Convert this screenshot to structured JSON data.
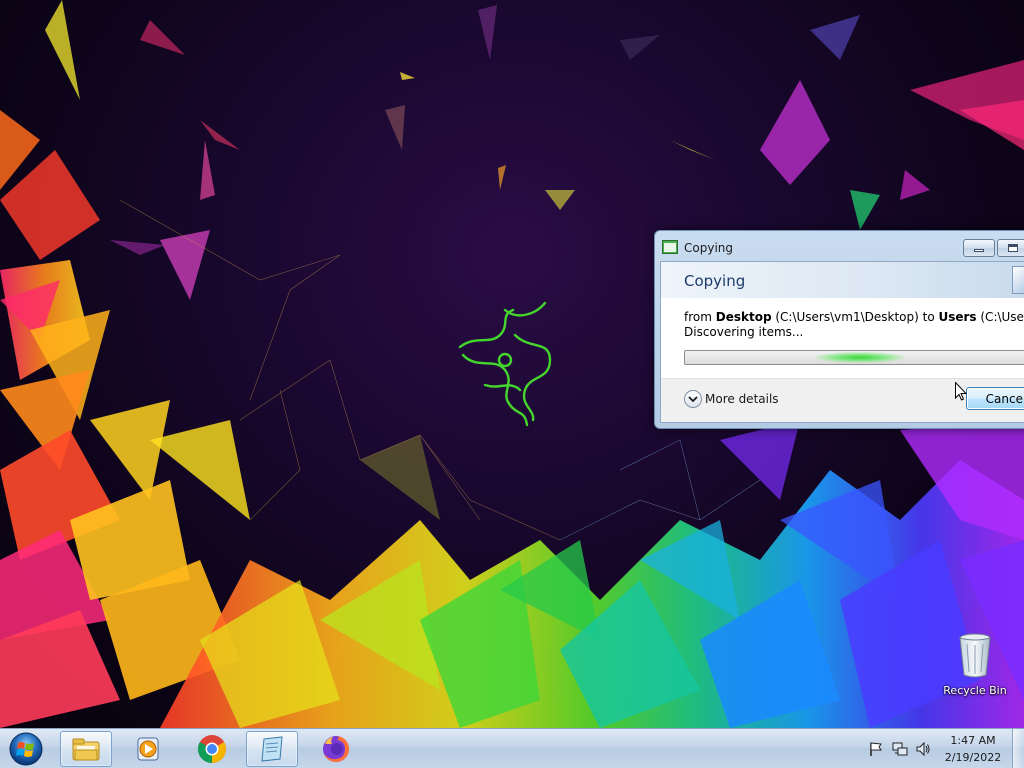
{
  "desktop": {
    "wallpaper": "razer-polygon-wallpaper",
    "recycle_bin": {
      "label": "Recycle Bin",
      "icon": "recycle-bin-icon"
    }
  },
  "copy_dialog": {
    "window_title": "Copying",
    "heading": "Copying",
    "from_prefix": "from ",
    "source_name": "Desktop",
    "source_path": " (C:\\Users\\vm1\\Desktop) to ",
    "dest_name": "Users",
    "dest_path": " (C:\\Users)",
    "status": "Discovering items...",
    "more_details_label": "More details",
    "cancel_label": "Cancel"
  },
  "taskbar": {
    "start": "windows-start-orb",
    "pinned": [
      {
        "name": "windows-explorer",
        "active": true
      },
      {
        "name": "windows-media-player",
        "active": false
      },
      {
        "name": "google-chrome",
        "active": false
      },
      {
        "name": "notepad",
        "active": true
      },
      {
        "name": "firefox",
        "active": false
      }
    ],
    "tray_icons": [
      "action-center-flag-icon",
      "network-icon",
      "volume-icon"
    ],
    "clock": {
      "time": "1:47 AM",
      "date": "2/19/2022"
    }
  },
  "colors": {
    "accent_green": "#44d62c",
    "dialog_frame": "#b4cbe4",
    "taskbar": "#c4d4e8"
  }
}
